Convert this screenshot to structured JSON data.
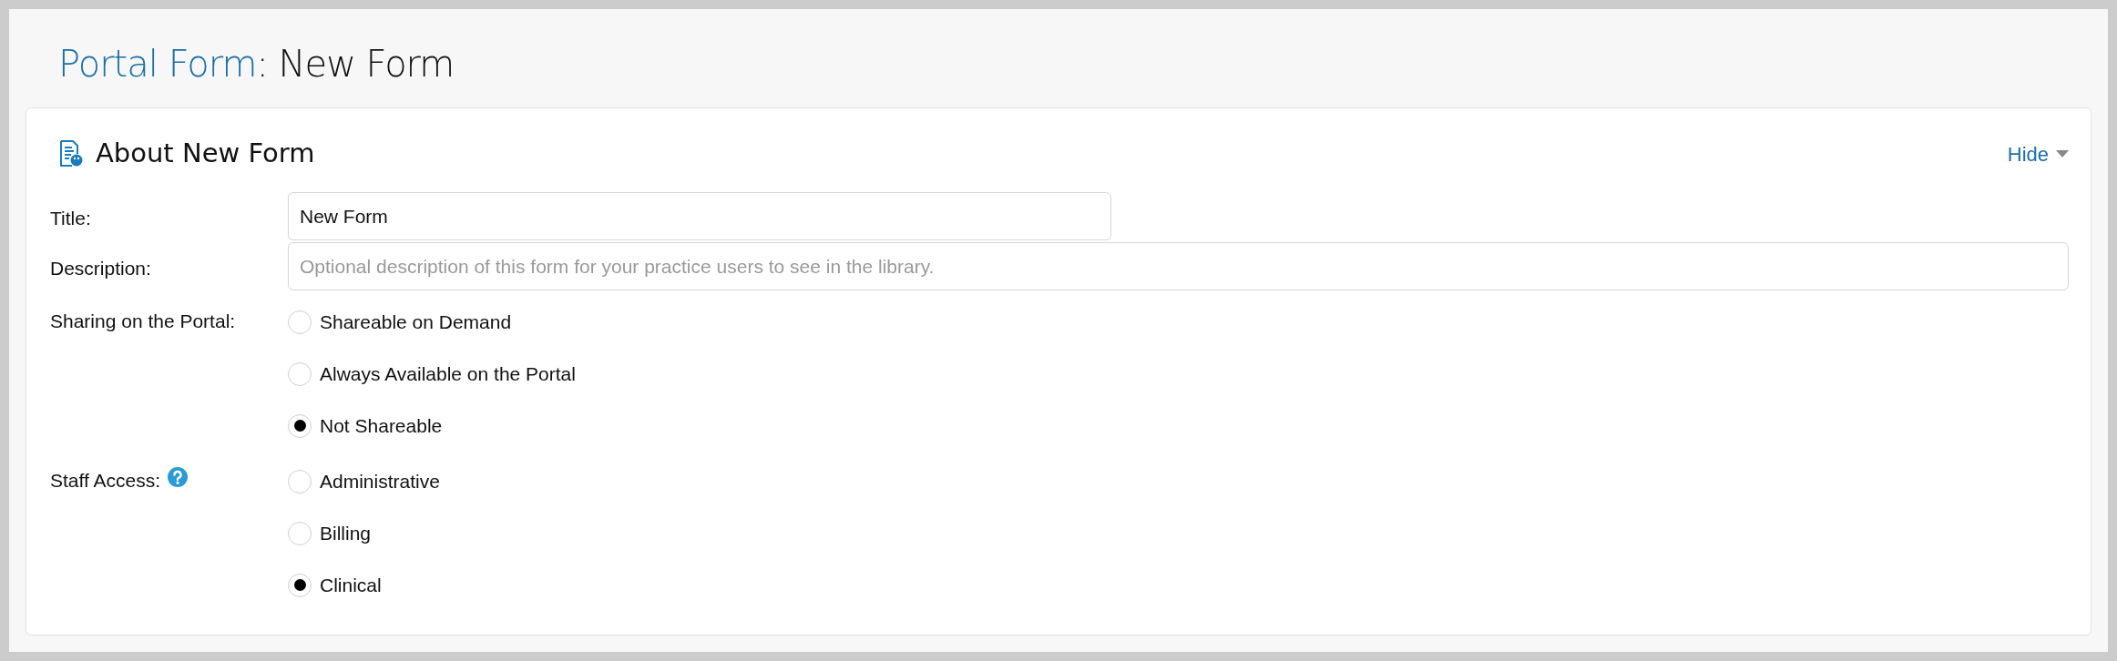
{
  "page_title": {
    "link": "Portal Form",
    "rest": ": New Form"
  },
  "section": {
    "title": "About New Form",
    "toggle": "Hide"
  },
  "fields": [
    {
      "kind": "text",
      "label": "Title:",
      "value": "New Form"
    },
    {
      "kind": "wide",
      "label": "Description:",
      "placeholder": "Optional description of this form for your practice users to see in the library."
    },
    {
      "kind": "radio",
      "label": "Sharing on the Portal:",
      "help": false,
      "options": [
        {
          "label": "Shareable on Demand",
          "selected": false
        },
        {
          "label": "Always Available on the Portal",
          "selected": false
        },
        {
          "label": "Not Shareable",
          "selected": true
        }
      ]
    },
    {
      "kind": "radio",
      "label": "Staff Access:",
      "help": true,
      "options": [
        {
          "label": "Administrative",
          "selected": false
        },
        {
          "label": "Billing",
          "selected": false
        },
        {
          "label": "Clinical",
          "selected": true
        }
      ]
    }
  ]
}
